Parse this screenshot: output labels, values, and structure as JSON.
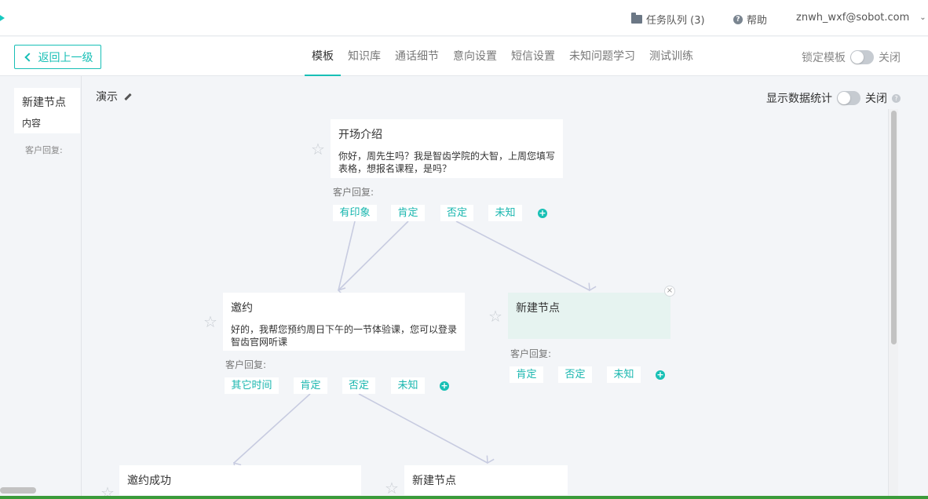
{
  "topbar": {
    "queue_label": "任务队列 (3)",
    "help_label": "帮助",
    "user_email": "znwh_wxf@sobot.com"
  },
  "subbar": {
    "back_label": "返回上一级",
    "tabs": [
      "模板",
      "知识库",
      "通话细节",
      "意向设置",
      "短信设置",
      "未知问题学习",
      "测试训练"
    ],
    "active_tab": "模板",
    "lock_label": "锁定模板",
    "lock_state": "关闭"
  },
  "left_panel": {
    "card_title": "新建节点",
    "card_content": "内容",
    "reply_label": "客户回复:"
  },
  "canvas": {
    "title": "演示",
    "stats_label": "显示数据统计",
    "stats_state": "关闭"
  },
  "nodes": {
    "intro": {
      "title": "开场介绍",
      "text": "你好，周先生吗？我是智齿学院的大智，上周您填写表格，想报名课程，是吗？",
      "reply_label": "客户回复:",
      "replies": [
        "有印象",
        "肯定",
        "否定",
        "未知"
      ]
    },
    "invite": {
      "title": "邀约",
      "text": "好的，我帮您预约周日下午的一节体验课，您可以登录智齿官网听课",
      "reply_label": "客户回复:",
      "replies": [
        "其它时间",
        "肯定",
        "否定",
        "未知"
      ]
    },
    "new_right": {
      "title": "新建节点",
      "reply_label": "客户回复:",
      "replies": [
        "肯定",
        "否定",
        "未知"
      ]
    },
    "success": {
      "title": "邀约成功"
    },
    "new_bottom": {
      "title": "新建节点"
    }
  },
  "colors": {
    "accent": "#17bfb6",
    "new_node_bg": "#e6f3f0",
    "edge": "#c7cbe0"
  }
}
